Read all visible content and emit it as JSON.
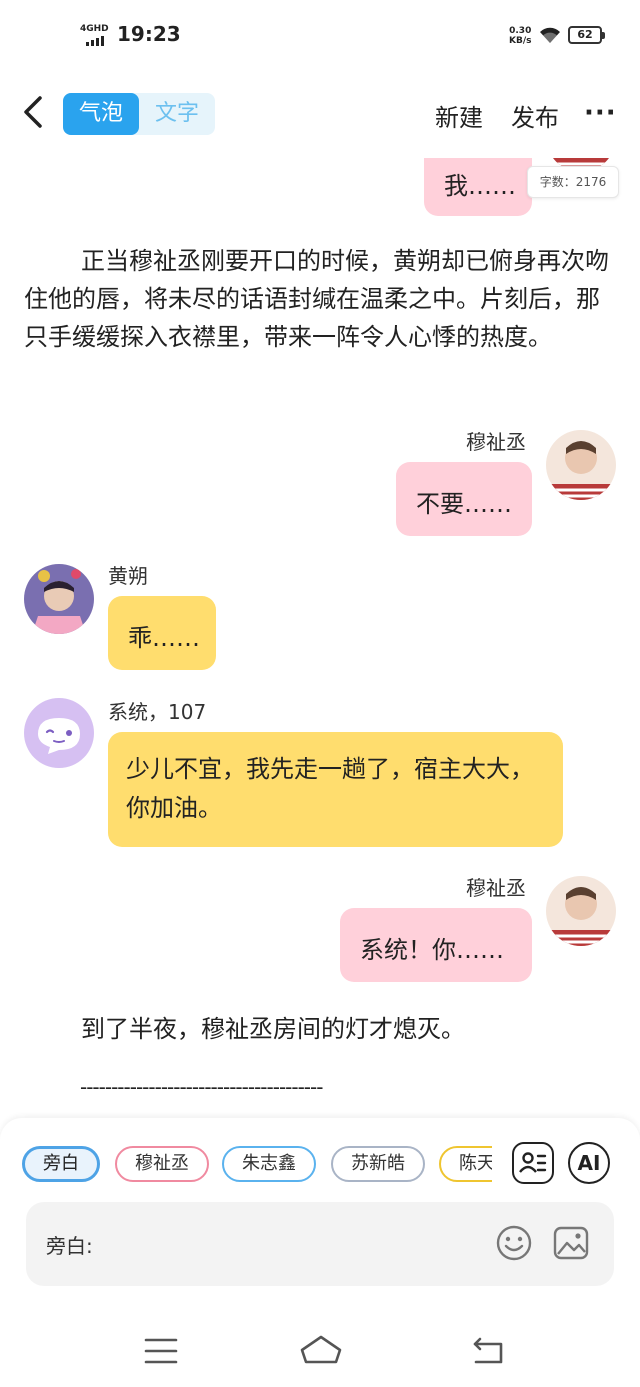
{
  "status": {
    "network": "4GHD",
    "time": "19:23",
    "speed_value": "0.30",
    "speed_unit": "KB/s",
    "battery": "62"
  },
  "header": {
    "tabs": [
      "气泡",
      "文字"
    ],
    "new_label": "新建",
    "publish_label": "发布",
    "more_label": "···"
  },
  "word_count": "字数：2176",
  "messages": {
    "m0_text": "我……",
    "narration1": "正当穆祉丞刚要开口的时候，黄朔却已俯身再次吻住他的唇，将未尽的话语封缄在温柔之中。片刻后，那只手缓缓探入衣襟里，带来一阵令人心悸的热度。",
    "m1_name": "穆祉丞",
    "m1_text": "不要……",
    "m2_name": "黄朔",
    "m2_text": "乖……",
    "m3_name": "系统，107",
    "m3_text": "少儿不宜，我先走一趟了，宿主大大，你加油。",
    "m4_name": "穆祉丞",
    "m4_text": "系统！你……",
    "narration2": "到了半夜，穆祉丞房间的灯才熄灭。",
    "divider": "---------------------------------------"
  },
  "composer": {
    "chips": [
      "旁白",
      "穆祉丞",
      "朱志鑫",
      "苏新皓",
      "陈天"
    ],
    "ai_label": "AI",
    "input_label": "旁白:"
  },
  "colors": {
    "accent": "#2aa3ee",
    "pink_bubble": "#ffd0da",
    "yellow_bubble": "#ffdd6e"
  }
}
